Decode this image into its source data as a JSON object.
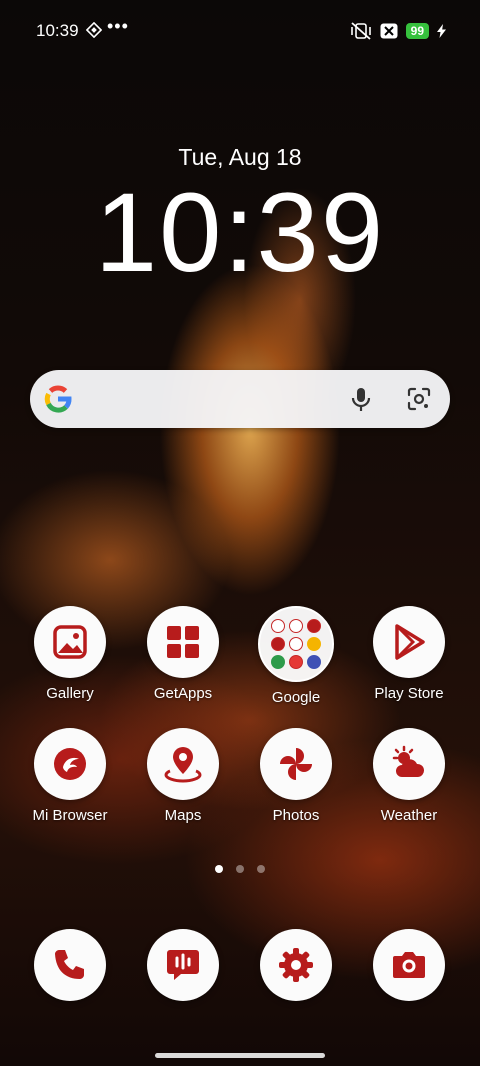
{
  "status_bar": {
    "time": "10:39",
    "more": "•••",
    "battery": "99",
    "icons": [
      "mute-vibrate-icon",
      "sim-off-icon",
      "battery-icon",
      "charging-icon"
    ],
    "battery_color": "#36c13d"
  },
  "clock": {
    "date": "Tue, Aug 18",
    "time": "10:39"
  },
  "search": {
    "icons": [
      "google-g-icon",
      "microphone-icon",
      "google-lens-icon"
    ]
  },
  "apps_row1": [
    {
      "label": "Gallery",
      "icon": "gallery-icon"
    },
    {
      "label": "GetApps",
      "icon": "getapps-icon"
    },
    {
      "label": "Google",
      "icon": "folder-icon"
    },
    {
      "label": "Play Store",
      "icon": "play-store-icon"
    }
  ],
  "apps_row2": [
    {
      "label": "Mi Browser",
      "icon": "mi-browser-icon"
    },
    {
      "label": "Maps",
      "icon": "maps-icon"
    },
    {
      "label": "Photos",
      "icon": "photos-icon"
    },
    {
      "label": "Weather",
      "icon": "weather-icon"
    }
  ],
  "dock": [
    {
      "icon": "phone-icon"
    },
    {
      "icon": "messages-icon"
    },
    {
      "icon": "settings-icon"
    },
    {
      "icon": "camera-icon"
    }
  ],
  "page_indicator": {
    "pages": 3,
    "current": 1
  },
  "accent_color": "#b71c1c"
}
